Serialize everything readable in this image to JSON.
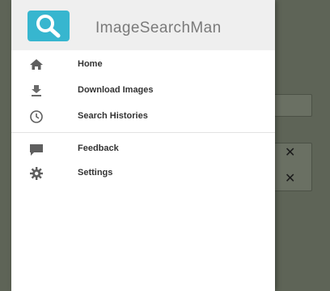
{
  "app": {
    "title": "ImageSearchMan",
    "accent_color": "#37b6cf"
  },
  "drawer": {
    "primary_items": [
      {
        "label": "Home",
        "icon": "home-icon"
      },
      {
        "label": "Download Images",
        "icon": "download-icon"
      },
      {
        "label": "Search Histories",
        "icon": "clock-icon"
      }
    ],
    "secondary_items": [
      {
        "label": "Feedback",
        "icon": "feedback-icon"
      },
      {
        "label": "Settings",
        "icon": "settings-icon"
      }
    ]
  },
  "background": {
    "scrim_color": "#5e6457",
    "close_glyph": "✕"
  }
}
